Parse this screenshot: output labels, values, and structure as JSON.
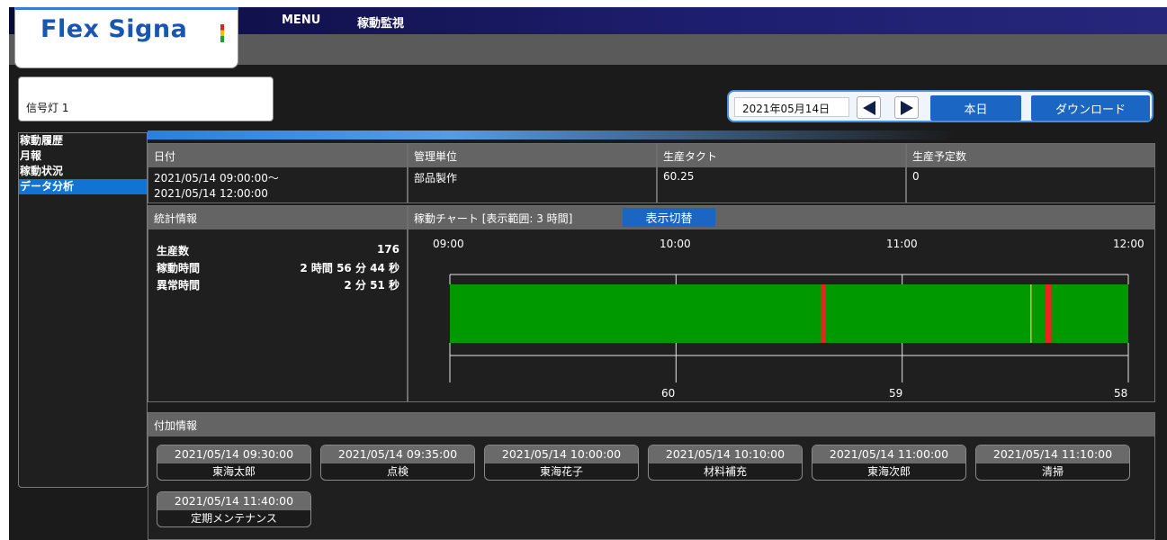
{
  "logo": {
    "text": "Flex Signa"
  },
  "nav": {
    "menu": "MENU",
    "monitor": "稼動監視"
  },
  "device": {
    "label": "信号灯 1"
  },
  "date_controls": {
    "date": "2021年05月14日",
    "today": "本日",
    "download": "ダウンロード"
  },
  "sidebar": {
    "items": [
      {
        "label": "稼動履歴"
      },
      {
        "label": "月報"
      },
      {
        "label": "稼動状況"
      },
      {
        "label": "データ分析"
      }
    ]
  },
  "info": {
    "date_head": "日付",
    "date_line1": "2021/05/14 09:00:00～",
    "date_line2": "2021/05/14 12:00:00",
    "unit_head": "管理単位",
    "unit_value": "部品製作",
    "takt_head": "生産タクト",
    "takt_value": "60.25",
    "planned_head": "生産予定数",
    "planned_value": "0"
  },
  "stats": {
    "head": "統計情報",
    "rows": [
      {
        "label": "生産数",
        "value": "176"
      },
      {
        "label": "稼動時間",
        "value": "2 時間 56 分 44 秒"
      },
      {
        "label": "異常時間",
        "value": "2 分 51 秒"
      }
    ]
  },
  "timeline": {
    "head": "稼動チャート  [表示範囲: 3 時間]",
    "switch_label": "表示切替",
    "hours": [
      "09:00",
      "10:00",
      "11:00",
      "12:00"
    ],
    "counts": [
      "60",
      "59",
      "58"
    ],
    "colors": {
      "running": "#009900",
      "alarm": "#ee2222",
      "warning": "#e0c040"
    },
    "events": [
      {
        "type": "alarm",
        "start": "10:38:30",
        "end": "10:39:45"
      },
      {
        "type": "warning",
        "start": "11:34:00",
        "end": "11:34:20"
      },
      {
        "type": "alarm",
        "start": "11:38:00",
        "end": "11:39:36"
      }
    ]
  },
  "additional": {
    "head": "付加情報",
    "items": [
      {
        "time": "2021/05/14 09:30:00",
        "note": "東海太郎"
      },
      {
        "time": "2021/05/14 09:35:00",
        "note": "点検"
      },
      {
        "time": "2021/05/14 10:00:00",
        "note": "東海花子"
      },
      {
        "time": "2021/05/14 10:10:00",
        "note": "材料補充"
      },
      {
        "time": "2021/05/14 11:00:00",
        "note": "東海次郎"
      },
      {
        "time": "2021/05/14 11:10:00",
        "note": "清掃"
      },
      {
        "time": "2021/05/14 11:40:00",
        "note": "定期メンテナンス"
      }
    ]
  }
}
